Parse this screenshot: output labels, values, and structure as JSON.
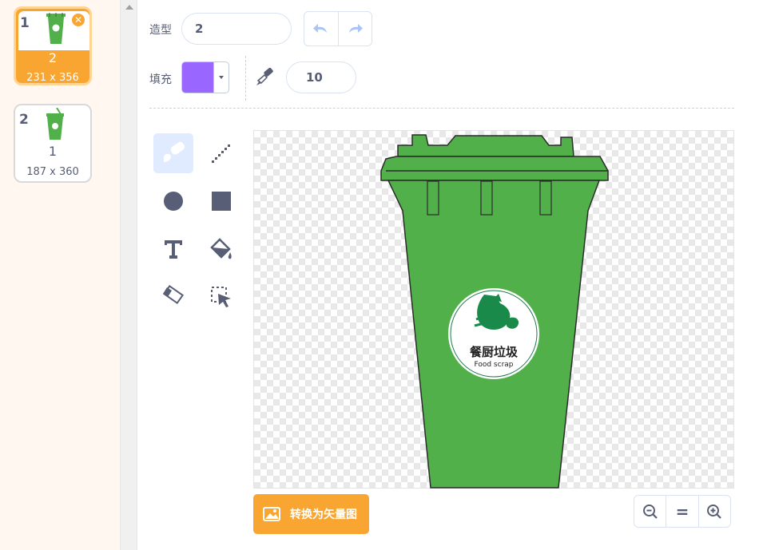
{
  "costumes": [
    {
      "number": "1",
      "name": "2",
      "size": "231 x 356",
      "selected": true,
      "delete_icon": "close-icon"
    },
    {
      "number": "2",
      "name": "1",
      "size": "187 x 360",
      "selected": false
    }
  ],
  "toolbar": {
    "costume_label": "造型",
    "costume_name": "2",
    "fill_label": "填充",
    "fill_color": "#9966ff",
    "brush_size": "10",
    "icons": [
      "undo-icon",
      "redo-icon",
      "brush-size-icon",
      "dropdown-arrow-icon"
    ]
  },
  "tools": [
    "brush-icon",
    "line-icon",
    "circle-icon",
    "rectangle-icon",
    "text-icon",
    "fill-bucket-icon",
    "eraser-icon",
    "select-icon"
  ],
  "canvas": {
    "logo_text_cn": "餐厨垃圾",
    "logo_text_en": "Food scrap",
    "bin_color": "#52b04a"
  },
  "bottom": {
    "convert_label": "转换为矢量图",
    "zoom_reset_label": "=",
    "icons": [
      "image-icon",
      "zoom-out-icon",
      "zoom-in-icon"
    ]
  },
  "colors": {
    "accent": "#f8a531",
    "selection_bg": "#e0ebff",
    "ui_text": "#575e75"
  }
}
